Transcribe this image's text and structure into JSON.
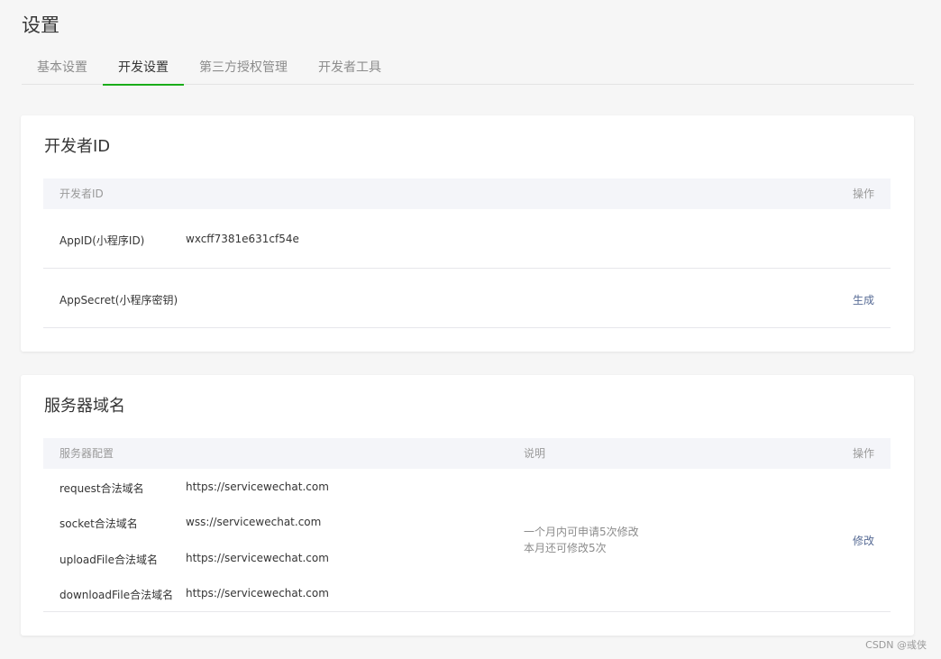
{
  "page": {
    "title": "设置"
  },
  "tabs": [
    {
      "label": "基本设置",
      "active": false
    },
    {
      "label": "开发设置",
      "active": true
    },
    {
      "label": "第三方授权管理",
      "active": false
    },
    {
      "label": "开发者工具",
      "active": false
    }
  ],
  "developer_id": {
    "title": "开发者ID",
    "header": {
      "col1": "开发者ID",
      "action": "操作"
    },
    "rows": [
      {
        "label": "AppID(小程序ID)",
        "value": "wxcff7381e631cf54e",
        "action": ""
      },
      {
        "label": "AppSecret(小程序密钥)",
        "value": "",
        "action": "生成"
      }
    ]
  },
  "server_domain": {
    "title": "服务器域名",
    "header": {
      "col1": "服务器配置",
      "col2": "说明",
      "action": "操作"
    },
    "rows": [
      {
        "label": "request合法域名",
        "value": "https://servicewechat.com"
      },
      {
        "label": "socket合法域名",
        "value": "wss://servicewechat.com"
      },
      {
        "label": "uploadFile合法域名",
        "value": "https://servicewechat.com"
      },
      {
        "label": "downloadFile合法域名",
        "value": "https://servicewechat.com"
      }
    ],
    "note": [
      "一个月内可申请5次修改",
      "本月还可修改5次"
    ],
    "action": "修改"
  },
  "watermark": "CSDN @彧侠",
  "colors": {
    "accent": "#1aad19",
    "link": "#576b95"
  }
}
